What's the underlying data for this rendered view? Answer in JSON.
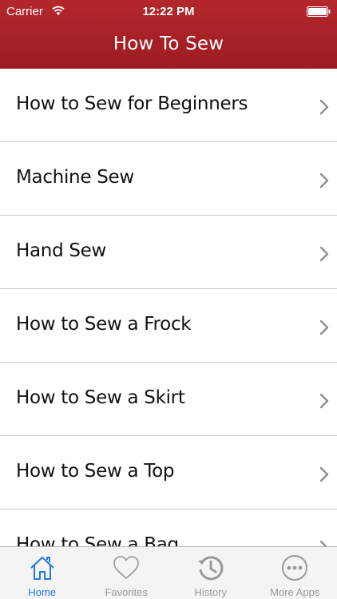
{
  "status": {
    "carrier": "Carrier",
    "time": "12:22 PM"
  },
  "header": {
    "title": "How To Sew"
  },
  "list": {
    "items": [
      {
        "label": "How to Sew for Beginners"
      },
      {
        "label": "Machine Sew"
      },
      {
        "label": "Hand Sew"
      },
      {
        "label": "How to Sew a Frock"
      },
      {
        "label": "How to Sew a Skirt"
      },
      {
        "label": "How to Sew a Top"
      },
      {
        "label": "How to Sew a Bag"
      }
    ]
  },
  "tabbar": {
    "tabs": [
      {
        "label": "Home",
        "icon": "home-icon",
        "active": true
      },
      {
        "label": "Favorites",
        "icon": "heart-icon",
        "active": false
      },
      {
        "label": "History",
        "icon": "history-icon",
        "active": false
      },
      {
        "label": "More Apps",
        "icon": "more-icon",
        "active": false
      }
    ]
  },
  "colors": {
    "header": "#a92328",
    "accent": "#1f7ae0",
    "inactive": "#9a9a9a"
  }
}
